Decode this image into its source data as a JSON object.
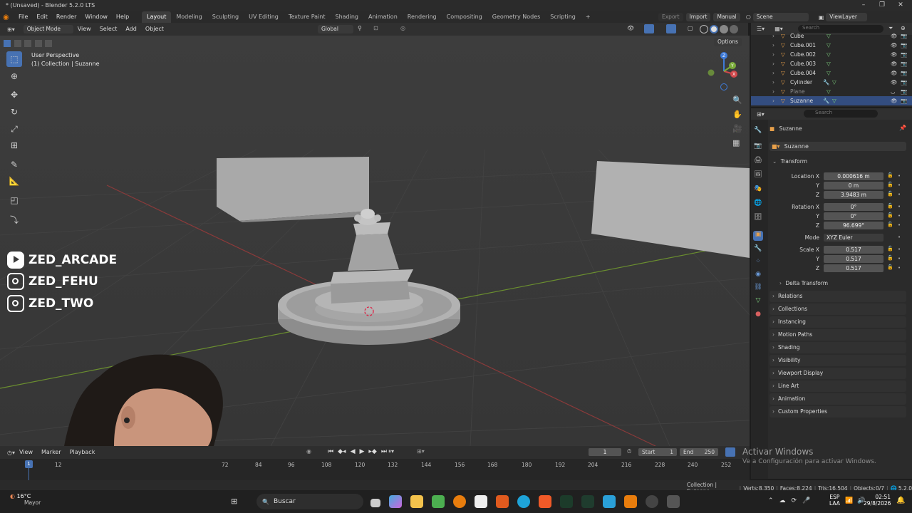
{
  "window": {
    "title": "* (Unsaved) - Blender 5.2.0 LTS"
  },
  "menubar": {
    "menus": [
      "File",
      "Edit",
      "Render",
      "Window",
      "Help"
    ],
    "workspaces": [
      "Layout",
      "Modeling",
      "Sculpting",
      "UV Editing",
      "Texture Paint",
      "Shading",
      "Animation",
      "Rendering",
      "Compositing",
      "Geometry Nodes",
      "Scripting"
    ],
    "active_workspace": "Layout",
    "export_label": "Export",
    "import_label": "Import",
    "manual_label": "Manual",
    "scene_value": "Scene",
    "viewlayer_value": "ViewLayer"
  },
  "viewport_header": {
    "mode": "Object Mode",
    "menus": [
      "View",
      "Select",
      "Add",
      "Object"
    ],
    "orientation": "Global",
    "options_label": "Options"
  },
  "viewport": {
    "perspective_label": "User Perspective",
    "collection_label": "(1) Collection | Suzanne",
    "overlay_socials": [
      "ZED_ARCADE",
      "ZED_FEHU",
      "ZED_TWO"
    ],
    "axis_x": "X",
    "axis_y": "Y",
    "axis_z": "Z"
  },
  "outliner": {
    "search_placeholder": "Search",
    "items": [
      {
        "name": "Cube",
        "type": "mesh"
      },
      {
        "name": "Cube.001",
        "type": "mesh"
      },
      {
        "name": "Cube.002",
        "type": "mesh"
      },
      {
        "name": "Cube.003",
        "type": "mesh"
      },
      {
        "name": "Cube.004",
        "type": "mesh"
      },
      {
        "name": "Cylinder",
        "type": "mesh"
      },
      {
        "name": "Plane",
        "type": "mesh"
      },
      {
        "name": "Suzanne",
        "type": "mesh"
      }
    ]
  },
  "properties": {
    "search_placeholder": "Search",
    "object_name": "Suzanne",
    "datablock_name": "Suzanne",
    "transform_label": "Transform",
    "location_label": "Location X",
    "location": [
      "0.000616 m",
      "0 m",
      "3.9483 m"
    ],
    "rotation_label": "Rotation X",
    "rotation": [
      "0°",
      "0°",
      "96.699°"
    ],
    "mode_label": "Mode",
    "mode_value": "XYZ Euler",
    "scale_label": "Scale X",
    "scale": [
      "0.517",
      "0.517",
      "0.517"
    ],
    "axis_y": "Y",
    "axis_z": "Z",
    "delta_transform": "Delta Transform",
    "panels": [
      "Relations",
      "Collections",
      "Instancing",
      "Motion Paths",
      "Shading",
      "Visibility",
      "Viewport Display",
      "Line Art",
      "Animation",
      "Custom Properties"
    ]
  },
  "timeline": {
    "menus": [
      "View",
      "Marker",
      "Playback"
    ],
    "current_frame": "1",
    "start_label": "Start",
    "start_value": "1",
    "end_label": "End",
    "end_value": "250",
    "ruler_ticks": [
      "12",
      "72",
      "84",
      "96",
      "108",
      "120",
      "132",
      "144",
      "156",
      "168",
      "180",
      "192",
      "204",
      "216",
      "228",
      "240",
      "252"
    ],
    "playhead_frame": "1"
  },
  "watermark": {
    "line1": "Activar Windows",
    "line2": "Ve a Configuración para activar Windows."
  },
  "statusbar": {
    "breadcrumb": "Collection | Suzanne",
    "verts": "Verts:8,350",
    "faces": "Faces:8,224",
    "tris": "Tris:16,504",
    "objects": "Objects:0/7",
    "version": "5.2.0"
  },
  "taskbar": {
    "weather_temp": "16°C",
    "weather_desc": "Mayor",
    "search_placeholder": "Buscar",
    "lang": "ESP",
    "lang_sub": "LAA",
    "time": "02:51",
    "date": "29/8/2026"
  },
  "colors": {
    "accent_blue": "#4772b3",
    "viewport_bg": "#3a3a3a",
    "panel_bg": "#2b2b2b",
    "mesh_orange": "#e8a04a",
    "modifier_green": "#7ed07e",
    "x_axis": "#a33b3b",
    "y_axis": "#7aa33a"
  }
}
